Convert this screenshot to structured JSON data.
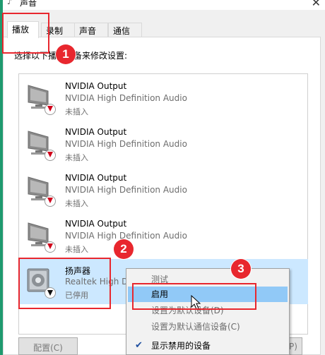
{
  "window": {
    "title": "声音",
    "close_symbol": "✕"
  },
  "tabs": [
    {
      "label": "播放"
    },
    {
      "label": "录制"
    },
    {
      "label": "声音"
    },
    {
      "label": "通信"
    }
  ],
  "instruction": "选择以下播放设备来修改设置:",
  "devices": [
    {
      "name": "NVIDIA Output",
      "description": "NVIDIA High Definition Audio",
      "status": "未插入",
      "icon": "monitor-icon",
      "badge": "red-down-arrow"
    },
    {
      "name": "NVIDIA Output",
      "description": "NVIDIA High Definition Audio",
      "status": "未插入",
      "icon": "monitor-icon",
      "badge": "red-down-arrow"
    },
    {
      "name": "NVIDIA Output",
      "description": "NVIDIA High Definition Audio",
      "status": "未插入",
      "icon": "monitor-icon",
      "badge": "red-down-arrow"
    },
    {
      "name": "NVIDIA Output",
      "description": "NVIDIA High Definition Audio",
      "status": "未插入",
      "icon": "monitor-icon",
      "badge": "red-down-arrow"
    },
    {
      "name": "扬声器",
      "description": "Realtek High Definition Audio",
      "status": "已停用",
      "icon": "speaker-icon",
      "badge": "black-down-arrow",
      "selected": true
    }
  ],
  "context_menu": {
    "items": [
      {
        "label": "测试",
        "enabled": false
      },
      {
        "label": "启用",
        "enabled": true,
        "highlighted": true
      },
      {
        "label": "设置为默认设备(D)",
        "enabled": false
      },
      {
        "label": "设置为默认通信设备(C)",
        "enabled": false
      },
      {
        "label": "显示禁用的设备",
        "enabled": true,
        "checked": true
      }
    ]
  },
  "buttons": {
    "configure": "配置(C)",
    "properties": "P)"
  },
  "annotations": [
    {
      "number": "1"
    },
    {
      "number": "2"
    },
    {
      "number": "3"
    }
  ],
  "colors": {
    "annotation": "#e8272e",
    "selection": "#cce8ff",
    "menu_highlight": "#91c9f7"
  }
}
